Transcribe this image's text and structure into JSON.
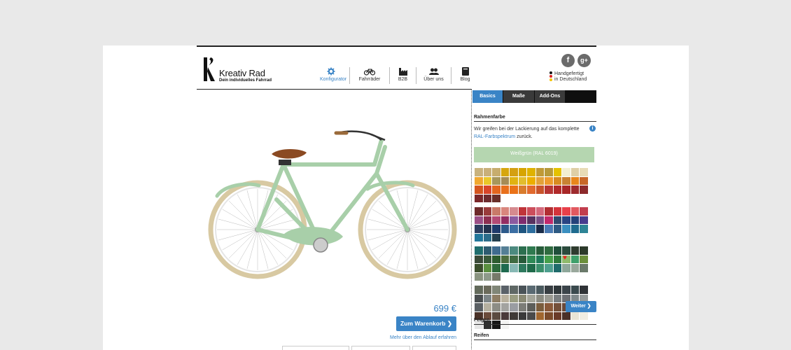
{
  "brand": {
    "name": "Kreativ Rad",
    "tagline": "Dein individuelles Fahrrad"
  },
  "nav": [
    {
      "label": "Konfigurator",
      "icon": "gear-icon",
      "active": true
    },
    {
      "label": "Fahrräder",
      "icon": "bicycle-icon",
      "active": false
    },
    {
      "label": "B2B",
      "icon": "factory-icon",
      "active": false
    },
    {
      "label": "Über uns",
      "icon": "people-icon",
      "active": false
    },
    {
      "label": "Blog",
      "icon": "book-icon",
      "active": false
    }
  ],
  "social": [
    {
      "label": "f",
      "icon": "facebook-icon"
    },
    {
      "label": "g+",
      "icon": "google-plus-icon"
    }
  ],
  "made_in": {
    "line1": "Handgefertigt",
    "line2": "in Deutschland",
    "flag_colors": [
      "#111111",
      "#dd2222",
      "#f5c400"
    ]
  },
  "product": {
    "price": "699 €",
    "cart_button": "Zum Warenkorb",
    "more_link": "Mehr über den Ablauf erfahren",
    "frame_color": "#a8cfa9",
    "tire_color": "#d8c9a2"
  },
  "config": {
    "tabs": [
      {
        "label": "Basics",
        "active": true
      },
      {
        "label": "Maße",
        "active": false
      },
      {
        "label": "Add-Ons",
        "active": false
      }
    ],
    "sections": {
      "frame": "Rahmenfarbe",
      "rims": "Felgen",
      "tires": "Reifen"
    },
    "description": {
      "text": "Wir greifen bei der Lackierung auf das komplette",
      "link": "RAL-Farbspektrum",
      "suffix": "zurück."
    },
    "selected_color": "Weißgrün (RAL 6019)",
    "selected_hex": "#b5d6b0",
    "next_button": "Weiter",
    "palette_groups": [
      [
        "#c8b27e",
        "#c9b07a",
        "#c7ad6e",
        "#d6a60f",
        "#d4a012",
        "#d7a500",
        "#dfb200",
        "#c09a36",
        "#b79a3a",
        "#e5c100",
        "#f2efd2",
        "#dfcfa6",
        "#e8dcb6",
        "#f0a830",
        "#eac72a",
        "#a7975b",
        "#a58c56",
        "#e0b312",
        "#e2bd2d",
        "#ecaf00",
        "#e2a23a",
        "#ee9b2d",
        "#d88b21",
        "#c88233",
        "#e8861c",
        "#c86728",
        "#d4551f",
        "#d8452a",
        "#e2661f",
        "#e8701c",
        "#ea7218",
        "#d97c2d",
        "#e16a2e",
        "#c8542b",
        "#b73634",
        "#b12a2a",
        "#a82728",
        "#9e2b2e",
        "#8d2a2c",
        "#7a272a",
        "#6d2b2e",
        "#6a2f2a"
      ],
      [
        "#6e2a2a",
        "#9a3b3b",
        "#c97a69",
        "#d9867e",
        "#d58a8f",
        "#c0343a",
        "#cc4e5c",
        "#d4697c",
        "#b22e32",
        "#d4343b",
        "#e8404a",
        "#e25960",
        "#c23e4e",
        "#9c4f86",
        "#8e2f50",
        "#b44a75",
        "#932e63",
        "#8b5aa0",
        "#7e2c6e",
        "#573360",
        "#7a4f85",
        "#c2296b",
        "#31496e",
        "#2a4483",
        "#24417a",
        "#473c8e",
        "#2d3e5f",
        "#24334e",
        "#1f3a6b",
        "#2d5a8a",
        "#3b6ea3",
        "#1e5580",
        "#2e6e9e",
        "#1a2c49",
        "#4a7ab3",
        "#2e5a83",
        "#3b8fc0",
        "#1f6b8f",
        "#2e8596",
        "#23779b",
        "#2c6d8b",
        "#25404f"
      ],
      [
        "#1f6d6d",
        "#2d5b70",
        "#3f6b8f",
        "#557f95",
        "#4c8a7f",
        "#2c6f4f",
        "#2f7a50",
        "#275d3a",
        "#2f6b3f",
        "#1f4f3a",
        "#2b4b3d",
        "#2e3b2e",
        "#2c3a2a",
        "#3b4a38",
        "#3a5a3a",
        "#2d5c2f",
        "#4e6e3f",
        "#3f6b42",
        "#285a3a",
        "#2f8a57",
        "#1f7a5a",
        "#45a04b",
        "#2e7a3a",
        "#8fba6c",
        "#3fa06a",
        "#6b8f3b",
        "#3b4e2c",
        "#5a8f3f",
        "#2d6a3b",
        "#1f6a4f",
        "#87b8b4",
        "#2e7a5e",
        "#1f6b4a",
        "#3a8f6b",
        "#4e9f8f",
        "#1f6b6b",
        "#8ea79a",
        "#9aa89c",
        "#6b7a6b",
        "#8a9480",
        "#8e9a8a",
        "#767a6a"
      ],
      [
        "#636a5b",
        "#6b6b5b",
        "#808677",
        "#5a6168",
        "#5f6865",
        "#4a5358",
        "#5a6a73",
        "#4b5a5f",
        "#383e42",
        "#2f373a",
        "#3b444a",
        "#3a4a4e",
        "#2f3337",
        "#4a4e50",
        "#7d8587",
        "#8e7e65",
        "#b9b19e",
        "#9a9d82",
        "#8a8a75",
        "#a4a59a",
        "#8c8c82",
        "#9a9a92",
        "#7a7e80",
        "#6d7075",
        "#808a8c",
        "#959a9a",
        "#5a5f63",
        "#b5b0a0",
        "#8d8d85",
        "#a3a3a0",
        "#9a9da2",
        "#7c7d78",
        "#5d5e5a",
        "#7a5d3d",
        "#8a5a3a",
        "#74503a",
        "#6a4a3a",
        "#7d4a30",
        "#5a3a2a",
        "#4a3228",
        "#6b4b3b",
        "#5b4a3f",
        "#4a3a3a",
        "#3f3a37",
        "#3a3a3a",
        "#4a4a4a",
        "#a0662e",
        "#7a4a2a",
        "#6a3a28",
        "#4a3028",
        "#e8e4d6",
        "#f0ede2",
        "#e6e6e6",
        "#303030",
        "#151515",
        "#f4f4f2"
      ]
    ],
    "selected_swatch": {
      "group": 2,
      "index": 23
    }
  }
}
